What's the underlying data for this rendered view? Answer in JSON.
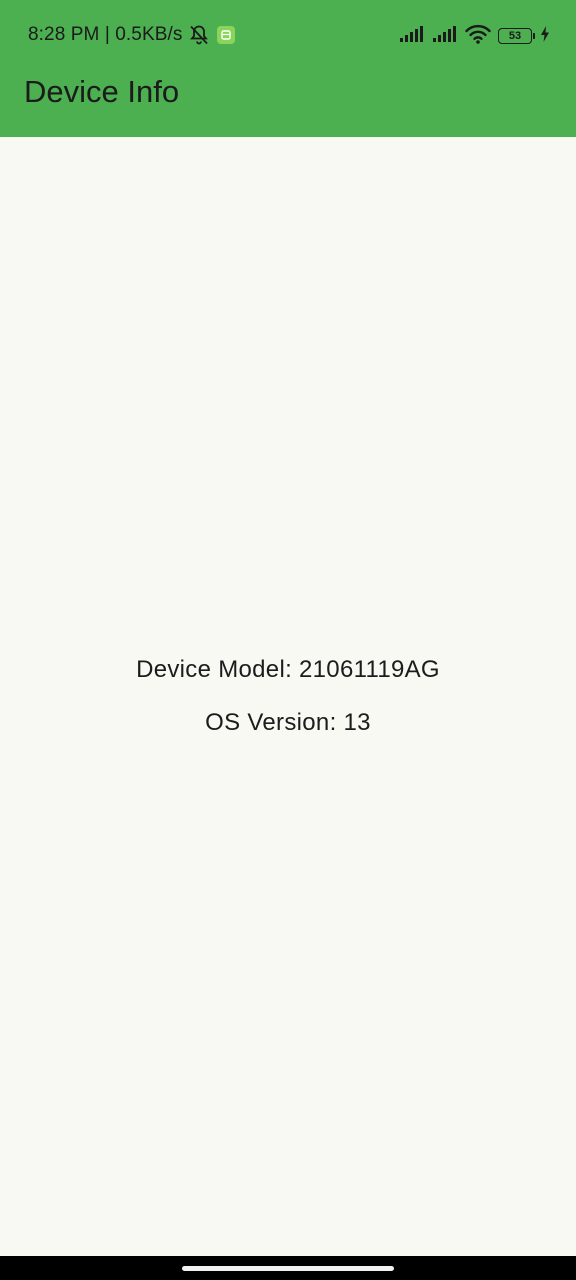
{
  "status_bar": {
    "time": "8:28 PM",
    "separator": " | ",
    "net_speed": "0.5KB/s",
    "battery_level": "53",
    "icons": [
      "bell-off-icon",
      "android-notification-icon",
      "signal-icon",
      "signal-icon",
      "wifi-icon",
      "battery-icon",
      "charging-icon"
    ]
  },
  "app_bar": {
    "title": "Device Info",
    "color": "#4caf50"
  },
  "content": {
    "device_model": "Device Model: 21061119AG",
    "os_version": "OS Version: 13"
  }
}
